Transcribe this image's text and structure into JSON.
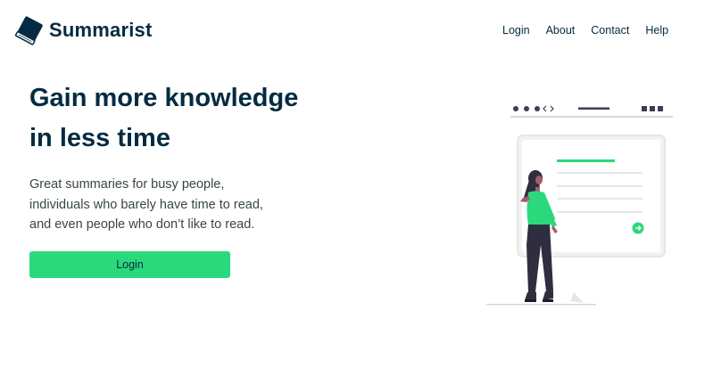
{
  "brand": {
    "name": "Summarist",
    "logo_icon": "book-icon"
  },
  "nav": {
    "links": [
      "Login",
      "About",
      "Contact",
      "Help"
    ]
  },
  "hero": {
    "title_lines": [
      "Gain more knowledge",
      "in less time"
    ],
    "subtitle_lines": [
      "Great summaries for busy people,",
      "individuals who barely have time to read,",
      "and even people who don’t like to read."
    ],
    "login_button": "Login"
  },
  "colors": {
    "primary_text": "#032b41",
    "accent": "#2bd97c",
    "body_text": "#394547"
  },
  "illustration": {
    "icon": "woman-reading-screen-illustration"
  }
}
